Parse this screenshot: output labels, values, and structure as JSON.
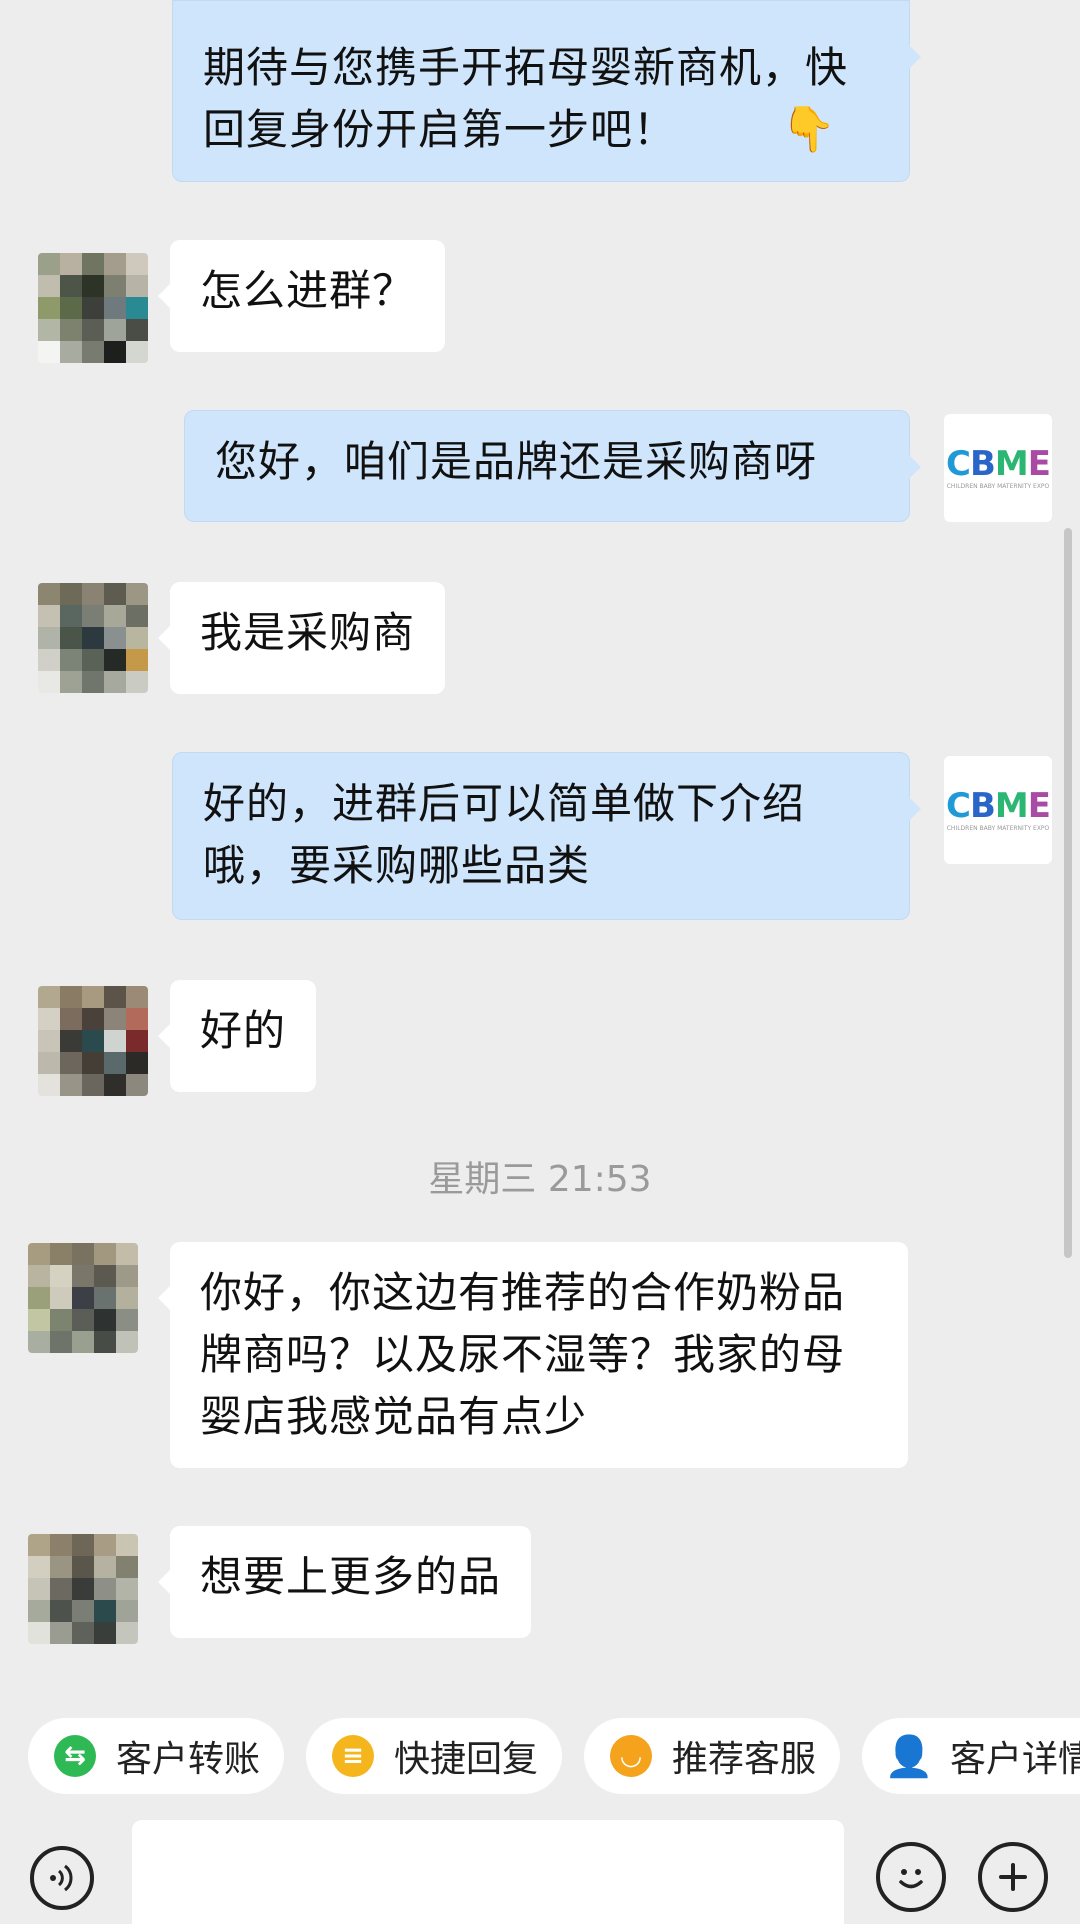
{
  "chat": {
    "messages": [
      {
        "side": "right",
        "text": "期待与您携手开拓母婴新商机，快回复身份开启第一步吧！",
        "emoji": "👇"
      },
      {
        "side": "left",
        "text": "怎么进群？"
      },
      {
        "side": "right",
        "text": "您好，咱们是品牌还是采购商呀"
      },
      {
        "side": "left",
        "text": "我是采购商"
      },
      {
        "side": "right",
        "text": "好的，进群后可以简单做下介绍哦，要采购哪些品类"
      },
      {
        "side": "left",
        "text": "好的"
      },
      {
        "side": "left",
        "text": "你好，你这边有推荐的合作奶粉品牌商吗？以及尿不湿等？我家的母婴店我感觉品有点少"
      },
      {
        "side": "left",
        "text": "想要上更多的品"
      }
    ],
    "timestamp": "星期三 21:53",
    "agent_logo": {
      "text": "CBME",
      "subtitle": "CHILDREN BABY MATERNITY EXPO"
    }
  },
  "quick_actions": [
    {
      "label": "客户转账",
      "icon": "transfer-icon",
      "color": "#2fb954"
    },
    {
      "label": "快捷回复",
      "icon": "quick-reply-icon",
      "color": "#f5b51c"
    },
    {
      "label": "推荐客服",
      "icon": "recommend-agent-icon",
      "color": "#f5a31c"
    },
    {
      "label": "客户详情",
      "icon": "customer-detail-icon",
      "color": "#2fb954"
    }
  ],
  "input_bar": {
    "voice_icon": "voice-icon",
    "emoji_icon": "emoji-icon",
    "plus_icon": "plus-icon"
  },
  "colors": {
    "background": "#ededed",
    "agent_bubble": "#cfe5fb",
    "customer_bubble": "#ffffff"
  }
}
